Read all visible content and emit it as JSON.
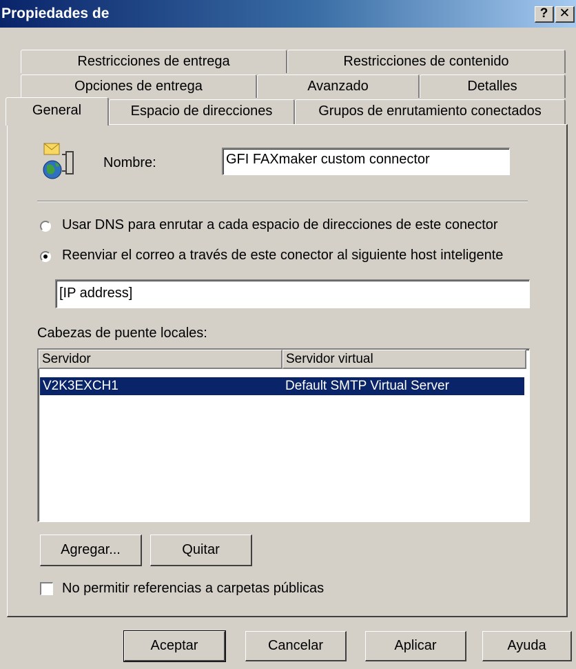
{
  "window": {
    "title": "Propiedades de",
    "help_button": "?",
    "close_button": "✕"
  },
  "tabs": {
    "row1": [
      "Restricciones de entrega",
      "Restricciones de contenido"
    ],
    "row2": [
      "Opciones de entrega",
      "Avanzado",
      "Detalles"
    ],
    "row3": [
      "General",
      "Espacio de direcciones",
      "Grupos de enrutamiento conectados"
    ],
    "active": "General"
  },
  "general": {
    "name_label": "Nombre:",
    "name_value": "GFI FAXmaker custom connector",
    "radio_dns_label": "Usar DNS para enrutar a cada espacio de direcciones de este conector",
    "radio_smarthost_label": "Reenviar el correo a través de este conector al siguiente host inteligente",
    "selected_radio": "smarthost",
    "smarthost_value": "[IP address]",
    "bridgeheads_label": "Cabezas de puente locales:",
    "table": {
      "columns": [
        "Servidor",
        "Servidor virtual"
      ],
      "rows": [
        {
          "server": "V2K3EXCH1",
          "virtual_server": "Default SMTP Virtual Server",
          "selected": true
        }
      ]
    },
    "add_button": "Agregar...",
    "remove_button": "Quitar",
    "public_folder_checkbox_label": "No permitir referencias a carpetas públicas",
    "public_folder_checked": false
  },
  "footer": {
    "ok": "Aceptar",
    "cancel": "Cancelar",
    "apply": "Aplicar",
    "help": "Ayuda"
  },
  "icons": {
    "connector": "mail-globe-connector-icon"
  }
}
